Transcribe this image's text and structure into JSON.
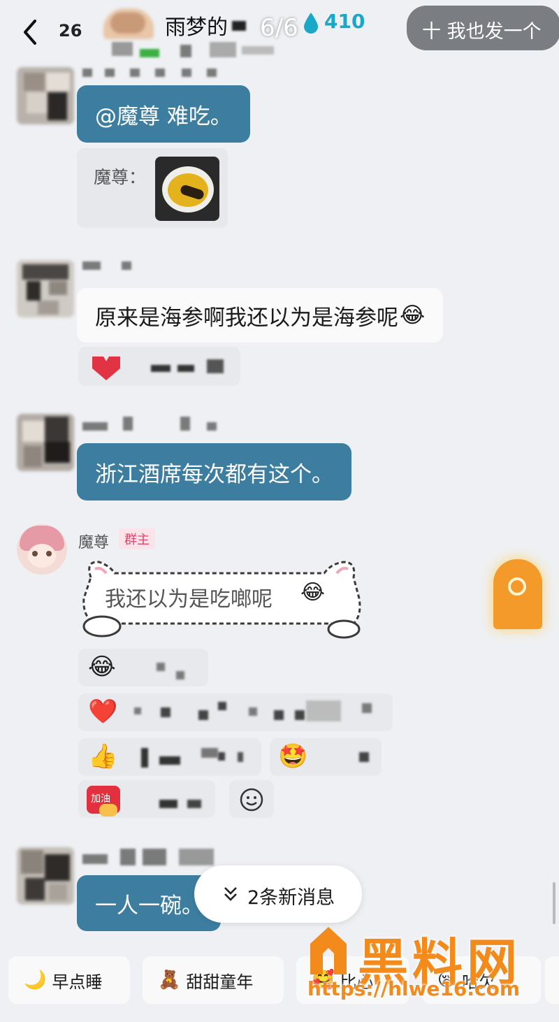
{
  "header": {
    "back_icon": "chevron-left-icon",
    "back_count": "26",
    "group_name": "雨梦的",
    "page_indicator": "6/6",
    "drop_icon": "water-drop-icon",
    "drop_count": "410",
    "post_button_label": "十 我也发一个"
  },
  "messages": [
    {
      "type": "text",
      "style": "blue",
      "text": "@魔尊 难吃。"
    },
    {
      "type": "quote",
      "sender": "魔尊：",
      "image": "food-photo"
    },
    {
      "type": "text",
      "style": "white",
      "text": "原来是海参啊我还以为是海参呢",
      "emoji": "😂"
    },
    {
      "type": "text",
      "style": "blue",
      "text": "浙江酒席每次都有这个。"
    },
    {
      "type": "text",
      "style": "cat-frame",
      "sender": "魔尊",
      "badge": "群主",
      "text": "我还以为是吃啷呢",
      "emoji": "😂"
    },
    {
      "type": "text",
      "style": "blue",
      "text": "一人一碗。"
    }
  ],
  "reactions": [
    {
      "icon": "😂"
    },
    {
      "icon": "❤️"
    },
    {
      "icon": "👍"
    },
    {
      "icon": "🤩"
    },
    {
      "icon": "加油-sticker",
      "label": "加油"
    },
    {
      "icon": "smiley-add-icon"
    }
  ],
  "new_messages_pill": "2条新消息",
  "quick_replies": [
    {
      "icon": "🌙",
      "label": "早点睡"
    },
    {
      "icon": "🧸",
      "label": "甜甜童年"
    },
    {
      "icon": "🥰",
      "label": "比心"
    },
    {
      "icon": "😪",
      "label": "哈欠"
    }
  ],
  "watermark": {
    "text": "黑料网",
    "url": "https://hlwe16.com"
  },
  "colors": {
    "background": "#eef0f3",
    "blue_bubble": "#3d7ea0",
    "white_bubble": "#fafafb",
    "owner_badge": "#e0436b",
    "drop": "#1aa8c8",
    "watermark": "#f28a1c"
  }
}
